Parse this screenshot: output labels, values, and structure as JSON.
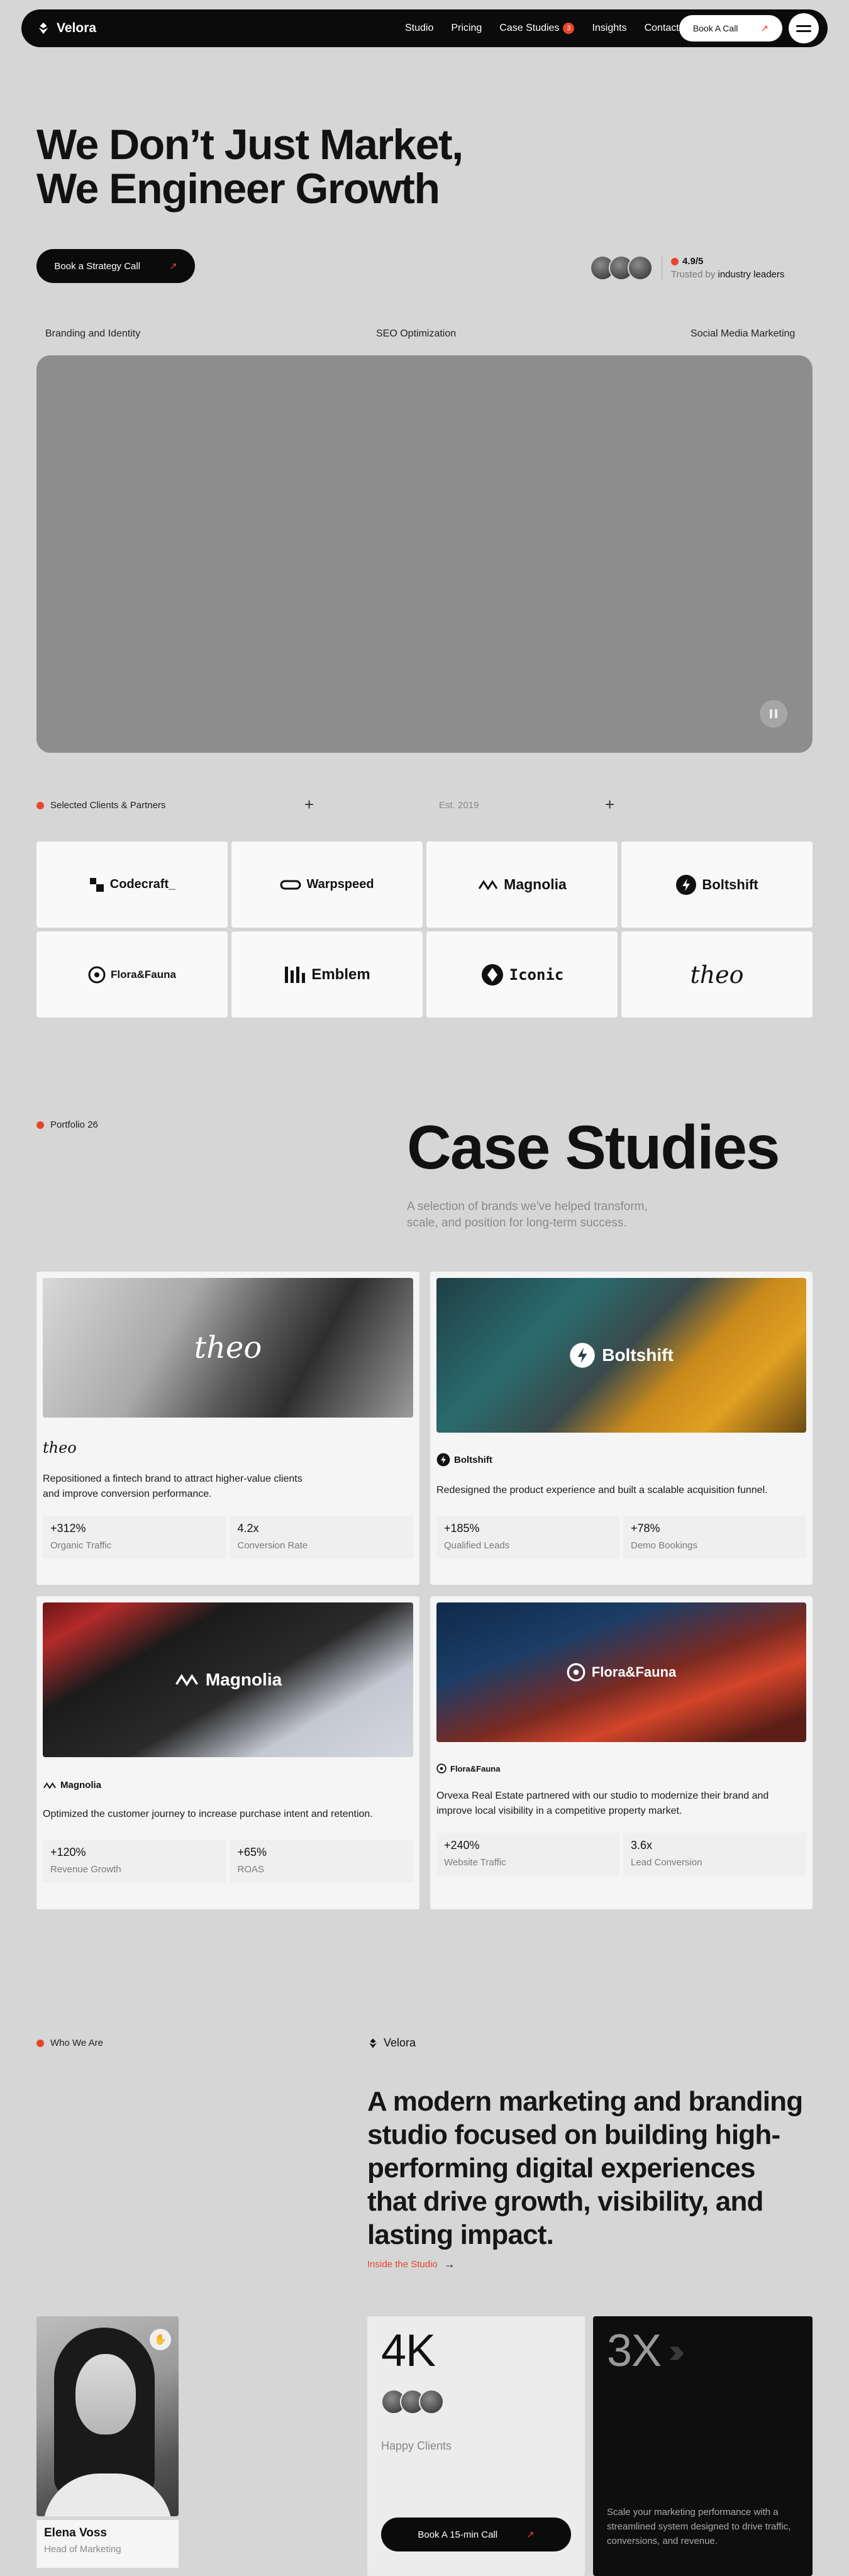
{
  "nav": {
    "brand": "Velora",
    "links": [
      "Studio",
      "Pricing",
      "Case Studies",
      "Insights",
      "Contact"
    ],
    "case_studies_badge": "3",
    "cta": "Book A Call"
  },
  "hero": {
    "title_line1": "We Don’t Just Market,",
    "title_line2": "We Engineer Growth",
    "cta": "Book a Strategy Call",
    "rating": "4.9/5",
    "trusted_prefix": "Trusted by",
    "trusted_strong": "industry leaders",
    "services": [
      "Branding and Identity",
      "SEO Optimization",
      "Social Media Marketing"
    ]
  },
  "clients": {
    "tag": "Selected Clients & Partners",
    "est": "Est. 2019",
    "logos": [
      "Codecraft_",
      "Warpspeed",
      "Magnolia",
      "Boltshift",
      "Flora&Fauna",
      "Emblem",
      "Iconic",
      "theo"
    ]
  },
  "case_studies": {
    "tag": "Portfolio 26",
    "title": "Case Studies",
    "subtitle": "A selection of brands we've helped transform, scale, and position for long-term success.",
    "cards": [
      {
        "brand": "theo",
        "desc": "Repositioned a fintech brand to attract higher-value clients and improve conversion performance.",
        "stats": [
          {
            "value": "+312%",
            "label": "Organic Traffic"
          },
          {
            "value": "4.2x",
            "label": "Conversion Rate"
          }
        ]
      },
      {
        "brand": "Boltshift",
        "desc": "Redesigned the product experience and built a scalable acquisition funnel.",
        "stats": [
          {
            "value": "+185%",
            "label": "Qualified Leads"
          },
          {
            "value": "+78%",
            "label": "Demo Bookings"
          }
        ]
      },
      {
        "brand": "Magnolia",
        "desc": "Optimized the customer journey to increase purchase intent and retention.",
        "stats": [
          {
            "value": "+120%",
            "label": "Revenue Growth"
          },
          {
            "value": "+65%",
            "label": "ROAS"
          }
        ]
      },
      {
        "brand": "Flora&Fauna",
        "desc": "Orvexa Real Estate partnered with our studio to modernize their brand and improve local visibility in a competitive property market.",
        "stats": [
          {
            "value": "+240%",
            "label": "Website Traffic"
          },
          {
            "value": "3.6x",
            "label": "Lead Conversion"
          }
        ]
      }
    ]
  },
  "who": {
    "tag": "Who We Are",
    "brand": "Velora",
    "headline": "A modern marketing and branding studio focused on building high-performing digital experiences that drive growth, visibility, and lasting impact.",
    "link": "Inside the Studio",
    "person_name": "Elena Voss",
    "person_role": "Head of Marketing",
    "happy_num": "4K",
    "happy_label": "Happy Clients",
    "call_cta": "Book A 15-min Call",
    "scale_num": "3X",
    "scale_desc": "Scale your marketing performance with a streamlined system designed to drive traffic, conversions, and revenue."
  }
}
